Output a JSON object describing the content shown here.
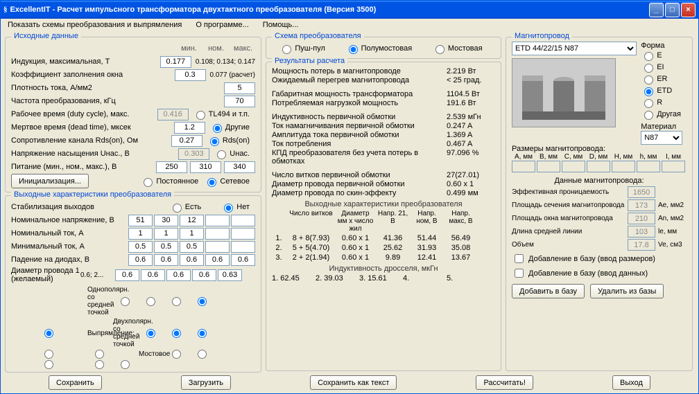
{
  "window": {
    "title": "ExcellentIT - Расчет импульсного трансформатора двухтактного преобразователя (Версия 3500)",
    "min": "0",
    "max": "1",
    "close": "r"
  },
  "menu": {
    "m1": "Показать схемы преобразования и выпрямления",
    "m2": "О программе...",
    "m3": "Помощь..."
  },
  "input": {
    "title": "Исходные данные",
    "hdr_min": "мин.",
    "hdr_nom": "ном.",
    "hdr_max": "макс.",
    "induction_lbl": "Индукция, максимальная, T",
    "induction": "0.177",
    "induction_hint": "0.108; 0.134; 0.147",
    "fill_lbl": "Коэффициент заполнения окна",
    "fill": "0.3",
    "fill_hint": "0.077 (расчет)",
    "density_lbl": "Плотность тока, A/мм2",
    "density": "5",
    "freq_lbl": "Частота преобразования, кГц",
    "freq": "70",
    "duty_lbl": "Рабочее время (duty cycle), макс.",
    "duty": "0.416",
    "duty_r1": "TL494 и т.п.",
    "dead_lbl": "Мертвое время (dead time), мксек",
    "dead": "1.2",
    "dead_r1": "Другие",
    "rds_lbl": "Сопротивление канала Rds(on), Ом",
    "rds": "0.27",
    "rds_r1": "Rds(on)",
    "unas_lbl": "Напряжение насыщения Uнас., В",
    "unas": "0.303",
    "unas_r1": "Uнас.",
    "power_lbl": "Питание (мин., ном., макс.), В",
    "p_min": "250",
    "p_nom": "310",
    "p_max": "340",
    "init_btn": "Инициализация...",
    "pwr_r1": "Постоянное",
    "pwr_r2": "Сетевое"
  },
  "output": {
    "title": "Выходные характеристики преобразователя",
    "stab_lbl": "Стабилизация выходов",
    "stab_yes": "Есть",
    "stab_no": "Нет",
    "vnom_lbl": "Номинальное напряжение, В",
    "v1": "51",
    "v2": "30",
    "v3": "12",
    "inom_lbl": "Номинальный ток, A",
    "i1": "1",
    "i2": "1",
    "i3": "1",
    "imin_lbl": "Минимальный ток, A",
    "im1": "0.5",
    "im2": "0.5",
    "im3": "0.5",
    "diode_lbl": "Падение на диодах, В",
    "d1": "0.6",
    "d2": "0.6",
    "d3": "0.6",
    "d4": "0.6",
    "d5": "0.6",
    "wire_lbl": "Диаметр провода 1 (желаемый)",
    "wire_hint": "0.6; 2...",
    "w1": "0.6",
    "w2": "0.6",
    "w3": "0.6",
    "w4": "0.6",
    "w5": "0.63",
    "rect_lbl": "Выпрямление:",
    "rect1": "Однополярн. со средней точкой",
    "rect2": "Двухполярн. со средней точкой",
    "rect3": "Мостовое"
  },
  "scheme": {
    "title": "Схема преобразователя",
    "r1": "Пуш-пул",
    "r2": "Полумостовая",
    "r3": "Мостовая"
  },
  "results": {
    "title": "Результаты расчета",
    "loss_lbl": "Мощность потерь в магнитопроводе",
    "loss": "2.219 Вт",
    "heat_lbl": "Ожидаемый перегрев магнитопровода",
    "heat": "< 25 град.",
    "gab_lbl": "Габаритная мощность трансформатора",
    "gab": "1104.5 Вт",
    "load_lbl": "Потребляемая нагрузкой мощность",
    "load": "191.6 Вт",
    "ind_lbl": "Индуктивность первичной обмотки",
    "ind": "2.539 мГн",
    "imag_lbl": "Ток намагничивания первичной обмотки",
    "imag": "0.247 A",
    "iamp_lbl": "Амплитуда тока первичной обмотки",
    "iamp": "1.369 A",
    "icons_lbl": "Ток потребления",
    "icons": "0.467 A",
    "eff_lbl": "КПД преобразователя без учета потерь в обмотках",
    "eff": "97.096 %",
    "turns_lbl": "Число витков первичной обмотки",
    "turns": "27(27.01)",
    "wdiam_lbl": "Диаметр провода первичной обмотки",
    "wdiam": "0.60 x 1",
    "skin_lbl": "Диаметр провода по скин-эффекту",
    "skin": "0.499 мм",
    "out_title": "Выходные характеристики преобразователя",
    "h_turns": "Число витков",
    "h_diam": "Диаметр мм x число жил",
    "h_v21": "Напр. 21, В",
    "h_vnom": "Напр. ном, В",
    "h_vmax": "Напр. макс, В",
    "r1_n": "1.",
    "r1_t": "8 + 8(7.93)",
    "r1_d": "0.60 x 1",
    "r1_v1": "41.36",
    "r1_v2": "51.44",
    "r1_v3": "56.49",
    "r2_n": "2.",
    "r2_t": "5 + 5(4.70)",
    "r2_d": "0.60 x 1",
    "r2_v1": "25.62",
    "r2_v2": "31.93",
    "r2_v3": "35.08",
    "r3_n": "3.",
    "r3_t": "2 + 2(1.94)",
    "r3_d": "0.60 x 1",
    "r3_v1": "9.89",
    "r3_v2": "12.41",
    "r3_v3": "13.67",
    "choke_title": "Индуктивность дросселя, мкГн",
    "ch1": "1. 62.45",
    "ch2": "2. 39.03",
    "ch3": "3. 15.61",
    "ch4": "4.",
    "ch5": "5."
  },
  "core": {
    "title": "Магнитопровод",
    "select": "ETD 44/22/15 N87",
    "form_lbl": "Форма",
    "f1": "E",
    "f2": "EI",
    "f3": "ER",
    "f4": "ETD",
    "f5": "R",
    "f6": "Другая",
    "mat_lbl": "Материал",
    "mat": "N87",
    "dims_title": "Размеры магнитопровода:",
    "dh": [
      "A, мм",
      "B, мм",
      "C, мм",
      "D, мм",
      "H, мм",
      "h, мм",
      "I, мм"
    ],
    "data_title": "Данные магнитопровода:",
    "perm_lbl": "Эффективная проницаемость",
    "perm": "1650",
    "ae_lbl": "Площадь сечения магнитопровода",
    "ae": "173",
    "ae_u": "Ae, мм2",
    "an_lbl": "Площадь окна магнитопровода",
    "an": "210",
    "an_u": "An, мм2",
    "le_lbl": "Длина средней линии",
    "le": "103",
    "le_u": "le, мм",
    "ve_lbl": "Объем",
    "ve": "17.8",
    "ve_u": "Ve, см3",
    "chk1": "Добавление в базу (ввод размеров)",
    "chk2": "Добавление в базу (ввод данных)",
    "btn_add": "Добавить в базу",
    "btn_del": "Удалить из базы"
  },
  "buttons": {
    "save": "Сохранить",
    "load": "Загрузить",
    "save_txt": "Сохранить как текст",
    "calc": "Рассчитать!",
    "exit": "Выход"
  }
}
